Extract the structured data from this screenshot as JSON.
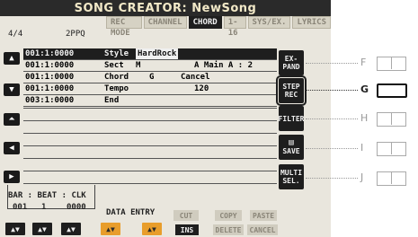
{
  "window": {
    "title": "SONG CREATOR: NewSong"
  },
  "tabs": [
    {
      "label": "REC MODE",
      "active": false
    },
    {
      "label": "CHANNEL",
      "active": false
    },
    {
      "label": "CHORD",
      "active": true
    },
    {
      "label": "1-16",
      "active": false
    },
    {
      "label": "SYS/EX.",
      "active": false
    },
    {
      "label": "LYRICS",
      "active": false
    }
  ],
  "header": {
    "time_signature": "4/4",
    "resolution": "2PPQ"
  },
  "events": [
    {
      "position": "001:1:0000",
      "type": "Style",
      "value": "HardRock",
      "extra": ""
    },
    {
      "position": "001:1:0000",
      "type": "Sect",
      "value": "M",
      "extra": "A  Main A  : 2"
    },
    {
      "position": "001:1:0000",
      "type": "Chord",
      "value": "G",
      "extra": "Cancel"
    },
    {
      "position": "001:1:0000",
      "type": "Tempo",
      "value": "",
      "extra": "120"
    },
    {
      "position": "003:1:0000",
      "type": "End",
      "value": "",
      "extra": ""
    }
  ],
  "right_buttons": {
    "expand": "EX-\nPAND",
    "step_rec": "STEP\nREC",
    "filter": "FILTER",
    "save": "SAVE",
    "multi_sel": "MULTI\nSEL."
  },
  "callouts": [
    "F",
    "G",
    "H",
    "I",
    "J"
  ],
  "bbc": {
    "header": "BAR : BEAT : CLK",
    "bar": "001",
    "beat": "1",
    "clk": "0000"
  },
  "bottom": {
    "data_entry": "DATA ENTRY",
    "cut": "CUT",
    "copy": "COPY",
    "paste": "PASTE",
    "ins": "INS",
    "delete": "DELETE",
    "cancel": "CANCEL"
  },
  "colors": {
    "accent": "#e89d2b",
    "screen_bg": "#e9e6dd",
    "dark": "#1e1e1e"
  }
}
